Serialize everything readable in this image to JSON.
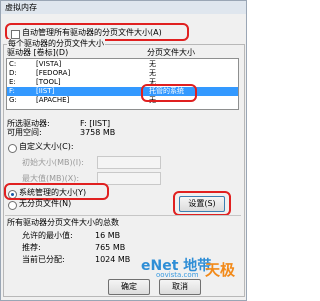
{
  "window": {
    "title": "虚拟内存"
  },
  "auto_manage": {
    "label": "自动管理所有驱动器的分页文件大小(A)",
    "checked": false
  },
  "paging_group": {
    "label": "每个驱动器的分页文件大小"
  },
  "list": {
    "headers": [
      "驱动器 [卷标](D)",
      "分页文件大小"
    ],
    "rows": [
      {
        "drive": "C:",
        "label": "[VISTA]",
        "size": "无",
        "selected": false
      },
      {
        "drive": "D:",
        "label": "[FEDORA]",
        "size": "无",
        "selected": false
      },
      {
        "drive": "E:",
        "label": "[TOOL]",
        "size": "无",
        "selected": false
      },
      {
        "drive": "F:",
        "label": "[IIST]",
        "size": "托管的系统",
        "selected": true
      },
      {
        "drive": "G:",
        "label": "[APACHE]",
        "size": "无",
        "selected": false
      }
    ]
  },
  "selected_drive": {
    "drive_label": "所选驱动器:",
    "drive_value": "F:    [IIST]",
    "space_label": "可用空间:",
    "space_value": "3758 MB"
  },
  "custom": {
    "label": "自定义大小(C):",
    "initial_label": "初始大小(MB)(I):",
    "max_label": "最大值(MB)(X):"
  },
  "system_managed": {
    "label": "系统管理的大小(Y)",
    "selected": true
  },
  "no_paging": {
    "label": "无分页文件(N)"
  },
  "set_button": {
    "label": "设置(S)"
  },
  "totals": {
    "heading": "所有驱动器分页文件大小的总数",
    "min_label": "允许的最小值:",
    "min_value": "16 MB",
    "rec_label": "推荐:",
    "rec_value": "765 MB",
    "cur_label": "当前已分配:",
    "cur_value": "1024 MB"
  },
  "buttons": {
    "ok": "确定",
    "cancel": "取消"
  },
  "watermark": {
    "site": "eNet 地带",
    "domain": "oovista.com",
    "brand": "天极"
  }
}
